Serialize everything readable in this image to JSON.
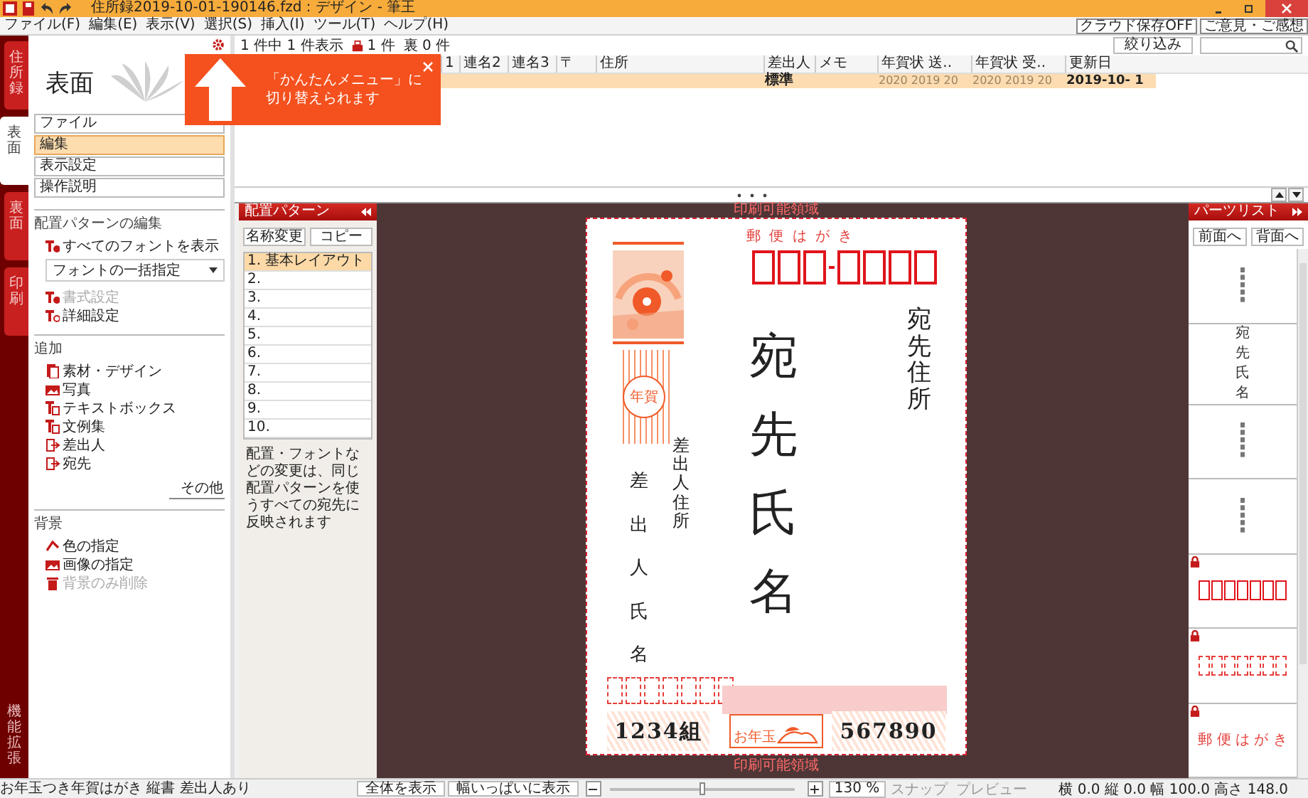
{
  "window": {
    "title": "住所録2019-10-01-190146.fzd：デザイン - 筆王"
  },
  "menu": [
    "ファイル(F)",
    "編集(E)",
    "表示(V)",
    "選択(S)",
    "挿入(I)",
    "ツール(T)",
    "ヘルプ(H)"
  ],
  "header_buttons": [
    "クラウド保存OFF",
    "ご意見・ご感想"
  ],
  "side_tabs": [
    {
      "label": "住所録",
      "selected": false
    },
    {
      "label": "表面",
      "selected": true
    },
    {
      "label": "裏面",
      "selected": false
    },
    {
      "label": "印刷",
      "selected": false
    }
  ],
  "side_extension": "機能拡張",
  "left_panel": {
    "title": "表面",
    "nav": [
      {
        "label": "ファイル",
        "selected": false
      },
      {
        "label": "編集",
        "selected": true
      },
      {
        "label": "表示設定",
        "selected": false
      },
      {
        "label": "操作説明",
        "selected": false
      }
    ],
    "sections": [
      {
        "heading": "配置パターンの編集",
        "items": [
          {
            "kind": "action",
            "label": "すべてのフォントを表示",
            "disabled": false
          },
          {
            "kind": "dropdown",
            "label": "フォントの一括指定",
            "disabled": false
          },
          {
            "kind": "action",
            "label": "書式設定",
            "disabled": true
          },
          {
            "kind": "action",
            "label": "詳細設定",
            "disabled": false
          }
        ]
      },
      {
        "heading": "追加",
        "items": [
          {
            "kind": "action",
            "label": "素材・デザイン",
            "disabled": false
          },
          {
            "kind": "action",
            "label": "写真",
            "disabled": false
          },
          {
            "kind": "action",
            "label": "テキストボックス",
            "disabled": false
          },
          {
            "kind": "action",
            "label": "文例集",
            "disabled": false
          },
          {
            "kind": "action",
            "label": "差出人",
            "disabled": false
          },
          {
            "kind": "action",
            "label": "宛先",
            "disabled": false
          }
        ],
        "more": "その他"
      },
      {
        "heading": "背景",
        "items": [
          {
            "kind": "action",
            "label": "色の指定",
            "disabled": false
          },
          {
            "kind": "action",
            "label": "画像の指定",
            "disabled": false
          },
          {
            "kind": "action",
            "label": "背景のみ削除",
            "disabled": true
          }
        ]
      }
    ]
  },
  "tooltip": {
    "lines": [
      "「かんたんメニュー」に",
      "切り替えられます"
    ]
  },
  "address_list": {
    "summary": "1 件中 1 件表示",
    "front_count": "1 件",
    "back_count": "裏 0 件",
    "filter_button": "絞り込み",
    "columns": [
      "1",
      "連名2",
      "連名3",
      "〒",
      "住所",
      "差出人",
      "メモ",
      "年賀状 送..",
      "年賀状 受..",
      "更新日"
    ],
    "rows": [
      {
        "selected": true,
        "sender": "標準",
        "nenga_sent": "2020 2019 20",
        "nenga_received": "2020 2019 20",
        "updated": "2019-10- 1"
      }
    ]
  },
  "pattern_panel": {
    "title": "配置パターン",
    "buttons": [
      "名称変更",
      "コピー"
    ],
    "patterns": [
      {
        "label": "1. 基本レイアウト",
        "selected": true
      },
      {
        "label": "2.",
        "selected": false
      },
      {
        "label": "3.",
        "selected": false
      },
      {
        "label": "4.",
        "selected": false
      },
      {
        "label": "5.",
        "selected": false
      },
      {
        "label": "6.",
        "selected": false
      },
      {
        "label": "7.",
        "selected": false
      },
      {
        "label": "8.",
        "selected": false
      },
      {
        "label": "9.",
        "selected": false
      },
      {
        "label": "10.",
        "selected": false
      }
    ],
    "note": "配置・フォントなどの変更は、同じ配置パターンを使うすべての宛先に反映されます"
  },
  "postcard": {
    "margin_label_top": "印刷可能領域",
    "postcard_label": "郵 便 は が き",
    "recipient_address": "宛先住所",
    "recipient_name": "宛先氏名",
    "stamp_text": "年賀",
    "sender_address": "差出人住所",
    "sender_name": "差出人氏名",
    "lottery_group": "1234組",
    "lottery_badge": "お年玉",
    "lottery_number": "567890",
    "margin_label_bottom": "印刷可能領域"
  },
  "parts_list": {
    "title": "パーツリスト",
    "buttons": [
      "前面へ",
      "背面へ"
    ],
    "items": [
      {
        "kind": "mini",
        "locked": false
      },
      {
        "kind": "text",
        "text": "宛先氏名",
        "locked": false
      },
      {
        "kind": "mini",
        "locked": false
      },
      {
        "kind": "mini",
        "locked": false
      },
      {
        "kind": "postal",
        "locked": true
      },
      {
        "kind": "dashed",
        "locked": true
      },
      {
        "kind": "label",
        "text": "郵 便 は が き",
        "locked": true
      }
    ]
  },
  "status_bar": {
    "description": "お年玉つき年賀はがき 縦書 差出人あり",
    "buttons": [
      "全体を表示",
      "幅いっぱいに表示"
    ],
    "zoom": {
      "level": 0.5,
      "value": "130 %"
    },
    "toggles": [
      {
        "label": "スナップ",
        "on": false
      },
      {
        "label": "プレビュー",
        "on": false
      }
    ],
    "coordinates": "横 0.0 縦 0.0 幅 100.0 高さ 148.0"
  }
}
